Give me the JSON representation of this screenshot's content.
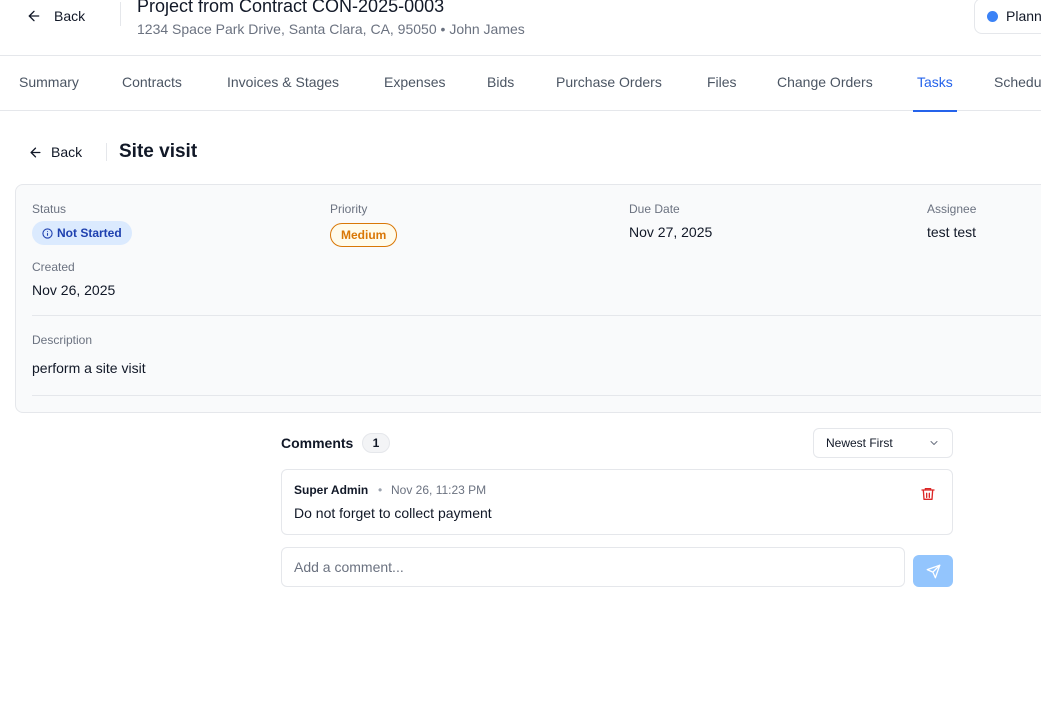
{
  "header": {
    "back_label": "Back",
    "title": "Project from Contract CON-2025-0003",
    "address": "1234 Space Park Drive, Santa Clara, CA, 95050",
    "separator": "•",
    "owner": "John James",
    "status": "Plann",
    "status_color": "#3b82f6"
  },
  "tabs": [
    {
      "label": "Summary"
    },
    {
      "label": "Contracts"
    },
    {
      "label": "Invoices & Stages"
    },
    {
      "label": "Expenses"
    },
    {
      "label": "Bids"
    },
    {
      "label": "Purchase Orders"
    },
    {
      "label": "Files"
    },
    {
      "label": "Change Orders"
    },
    {
      "label": "Tasks",
      "active": true
    },
    {
      "label": "Schedu"
    }
  ],
  "task": {
    "back_label": "Back",
    "title": "Site visit",
    "fields": {
      "status_label": "Status",
      "status_value": "Not Started",
      "priority_label": "Priority",
      "priority_value": "Medium",
      "due_label": "Due Date",
      "due_value": "Nov 27, 2025",
      "assignee_label": "Assignee",
      "assignee_value": "test test",
      "created_label": "Created",
      "created_value": "Nov 26, 2025",
      "description_label": "Description",
      "description_value": "perform a site visit"
    }
  },
  "comments": {
    "title": "Comments",
    "count": "1",
    "sort_value": "Newest First",
    "items": [
      {
        "author": "Super Admin",
        "separator": "•",
        "time": "Nov 26, 11:23 PM",
        "text": "Do not forget to collect payment"
      }
    ],
    "input_placeholder": "Add a comment..."
  },
  "colors": {
    "accent": "#2563eb",
    "status_badge_bg": "#dbeafe",
    "priority": "#d97706",
    "delete": "#dc2626",
    "send_button": "#93c5fd"
  },
  "icons": {
    "back": "arrow-left-icon",
    "status": "info-icon",
    "sort": "chevron-down-icon",
    "delete": "trash-icon",
    "send": "send-icon"
  }
}
